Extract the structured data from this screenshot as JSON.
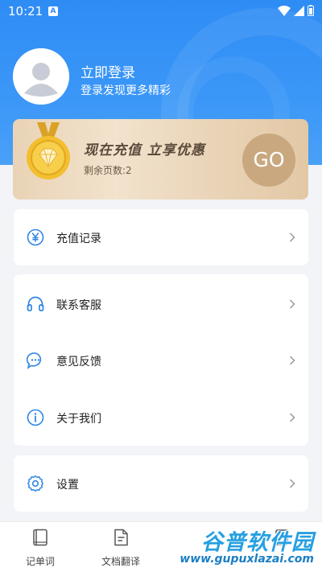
{
  "status_bar": {
    "time": "10:21",
    "notification_letter": "A"
  },
  "profile": {
    "title": "立即登录",
    "subtitle": "登录发现更多精彩"
  },
  "promo": {
    "slogan": "现在充值  立享优惠",
    "pages_text": "剩余页数:2",
    "go_label": "GO"
  },
  "menu": {
    "recharge": {
      "label": "充值记录",
      "icon": "yen-icon"
    },
    "support": {
      "label": "联系客服",
      "icon": "headset-icon"
    },
    "feedback": {
      "label": "意见反馈",
      "icon": "chat-bubble-icon"
    },
    "about": {
      "label": "关于我们",
      "icon": "info-icon"
    },
    "settings": {
      "label": "设置",
      "icon": "gear-icon"
    }
  },
  "tabbar": {
    "tabs": [
      {
        "label": "记单词",
        "icon": "book-icon"
      },
      {
        "label": "文档翻译",
        "icon": "document-icon"
      }
    ]
  },
  "watermark": {
    "title": "谷普软件园",
    "url": "www.gupuxlazai.com"
  },
  "colors": {
    "primary": "#2e8cf5",
    "icon_blue": "#2f86e6",
    "promo_gold": "#c9a880"
  }
}
